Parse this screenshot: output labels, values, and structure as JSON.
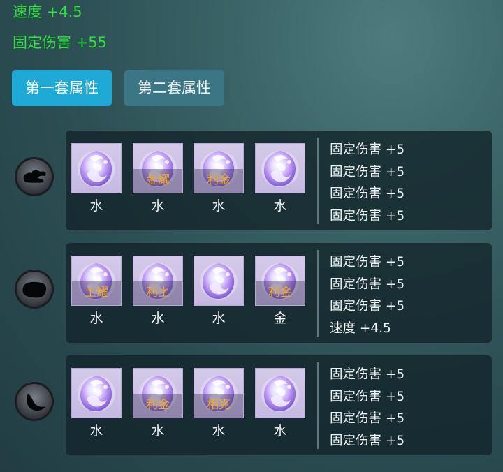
{
  "set_bonus": [
    "速度 +4.5",
    "固定伤害 +55"
  ],
  "tabs": [
    {
      "label": "第一套属性",
      "active": true
    },
    {
      "label": "第二套属性",
      "active": false
    }
  ],
  "groups": [
    {
      "emblem_icon": "cloud-swirl-emblem-icon",
      "gems": [
        {
          "element": "水",
          "tag": ""
        },
        {
          "element": "水",
          "tag": "金耀"
        },
        {
          "element": "水",
          "tag": "利金"
        },
        {
          "element": "水",
          "tag": ""
        }
      ],
      "stats": [
        "固定伤害 +5",
        "固定伤害 +5",
        "固定伤害 +5",
        "固定伤害 +5"
      ]
    },
    {
      "emblem_icon": "stone-emblem-icon",
      "gems": [
        {
          "element": "水",
          "tag": "土耀"
        },
        {
          "element": "水",
          "tag": "利土"
        },
        {
          "element": "水",
          "tag": ""
        },
        {
          "element": "金",
          "tag": "利金"
        }
      ],
      "stats": [
        "固定伤害 +5",
        "固定伤害 +5",
        "固定伤害 +5",
        "速度 +4.5"
      ]
    },
    {
      "emblem_icon": "droplet-emblem-icon",
      "gems": [
        {
          "element": "水",
          "tag": ""
        },
        {
          "element": "水",
          "tag": "利金"
        },
        {
          "element": "水",
          "tag": "相克"
        },
        {
          "element": "水",
          "tag": ""
        }
      ],
      "stats": [
        "固定伤害 +5",
        "固定伤害 +5",
        "固定伤害 +5",
        "固定伤害 +5"
      ]
    }
  ],
  "colors": {
    "bonus_text": "#2fe03a",
    "tab_active": "#1fa9d6",
    "tab_inactive": "#3c7685",
    "gem_tag": "#f0a921"
  }
}
